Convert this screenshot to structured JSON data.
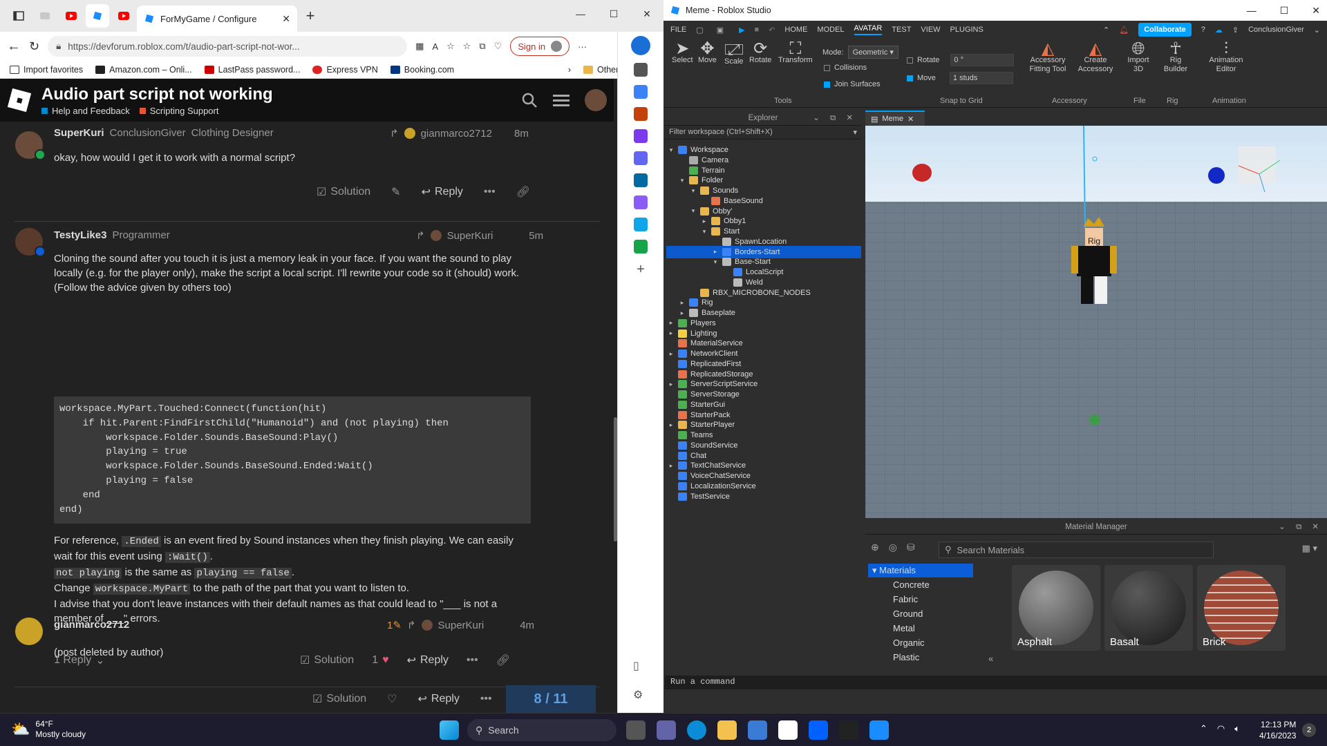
{
  "edge": {
    "tab_title": "ForMyGame / Configure",
    "url": "https://devforum.roblox.com/t/audio-part-script-not-wor...",
    "signin": "Sign in",
    "favorites": [
      "Import favorites",
      "Amazon.com – Onli...",
      "LastPass password...",
      "Express VPN",
      "Booking.com"
    ],
    "other_favorites": "Other favorites"
  },
  "forum": {
    "title": "Audio part script not working",
    "categories": [
      "Help and Feedback",
      "Scripting Support"
    ],
    "post1": {
      "user": "SuperKuri",
      "title": "ConclusionGiver",
      "subtitle": "Clothing Designer",
      "reply_to": "gianmarco2712",
      "time": "8m",
      "body": "okay, how would I get it to work with a normal script?",
      "solution": "Solution",
      "reply": "Reply"
    },
    "post2": {
      "user": "TestyLike3",
      "title": "Programmer",
      "reply_to": "SuperKuri",
      "time": "5m",
      "p1": "Cloning the sound after you touch it is just a memory leak in your face. If you want the sound to play locally (e.g. for the player only), make the script a local script. I'll rewrite your code so it (should) work. (Follow the advice given by others too)",
      "code": [
        "workspace.MyPart.Touched:Connect(function(hit)",
        "    if hit.Parent:FindFirstChild(\"Humanoid\") and (not playing) then",
        "        workspace.Folder.Sounds.BaseSound:Play()",
        "        playing = true",
        "        workspace.Folder.Sounds.BaseSound.Ended:Wait()",
        "        playing = false",
        "    end",
        "end)"
      ],
      "p2a": "For reference,",
      "p2code": ".Ended",
      "p2b": "is an event fired by Sound instances when they finish playing. We can easily wait for this event using",
      "p2code2": ":Wait()",
      "p2c": ".",
      "p3a": "not playing",
      "p3b": "is the same as",
      "p3c": "playing == false",
      "p3d": ".",
      "p4a": "Change",
      "p4code": "workspace.MyPart",
      "p4b": "to the path of the part that you want to listen to.",
      "p5": "I advise that you don't leave instances with their default names as that could lead to \"___ is not a member of ___\" errors.",
      "replies": "1 Reply",
      "solution": "Solution",
      "likes": "1",
      "reply": "Reply"
    },
    "post3": {
      "user": "gianmarco2712",
      "edits": "1",
      "reply_to": "SuperKuri",
      "time": "4m",
      "body": "(post deleted by author)",
      "solution": "Solution",
      "reply": "Reply"
    },
    "progress": "8 / 11"
  },
  "studio": {
    "title": "Meme - Roblox Studio",
    "menus": [
      "FILE",
      "HOME",
      "MODEL",
      "AVATAR",
      "TEST",
      "VIEW",
      "PLUGINS"
    ],
    "active_menu": "AVATAR",
    "collaborate": "Collaborate",
    "user": "ConclusionGiver",
    "tools": [
      "Select",
      "Move",
      "Scale",
      "Rotate",
      "Transform"
    ],
    "mode_label": "Mode:",
    "mode_value": "Geometric",
    "collisions": "Collisions",
    "join_surfaces": "Join Surfaces",
    "rotate_label": "Rotate",
    "rotate_value": "0 °",
    "move_label": "Move",
    "move_value": "1 studs",
    "accessory": [
      "Accessory Fitting Tool",
      "Create Accessory"
    ],
    "import3d": "Import 3D",
    "rig_builder": "Rig Builder",
    "anim_editor": "Animation Editor",
    "groups": [
      "Tools",
      "Snap to Grid",
      "Accessory",
      "File",
      "Rig",
      "Animation"
    ],
    "explorer_title": "Explorer",
    "filter": "Filter workspace (Ctrl+Shift+X)",
    "doc_tab": "Meme",
    "tree": [
      "Workspace",
      "Camera",
      "Terrain",
      "Folder",
      "Sounds",
      "BaseSound",
      "Obby'",
      "Obby1",
      "Start",
      "SpawnLocation",
      "Borders-Start",
      "Base-Start",
      "LocalScript",
      "Weld",
      "RBX_MICROBONE_NODES",
      "Rig",
      "Baseplate",
      "Players",
      "Lighting",
      "MaterialService",
      "NetworkClient",
      "ReplicatedFirst",
      "ReplicatedStorage",
      "ServerScriptService",
      "ServerStorage",
      "StarterGui",
      "StarterPack",
      "StarterPlayer",
      "Teams",
      "SoundService",
      "Chat",
      "TextChatService",
      "VoiceChatService",
      "LocalizationService",
      "TestService"
    ],
    "rig_label": "Rig",
    "matmgr_title": "Material Manager",
    "search_materials": "Search Materials",
    "mat_list": [
      "Materials",
      "Concrete",
      "Fabric",
      "Ground",
      "Metal",
      "Organic",
      "Plastic"
    ],
    "mat_cards": [
      "Asphalt",
      "Basalt",
      "Brick"
    ],
    "command": "Run a command"
  },
  "taskbar": {
    "weather_temp": "64°F",
    "weather_desc": "Mostly cloudy",
    "search": "Search",
    "time": "12:13 PM",
    "date": "4/16/2023",
    "notif": "2"
  }
}
